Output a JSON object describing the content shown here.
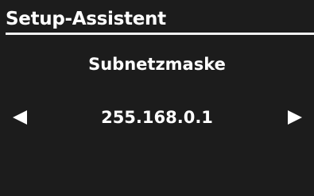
{
  "header": {
    "title": "Setup-Assistent"
  },
  "field": {
    "label": "Subnetzmaske",
    "value": "255.168.0.1"
  },
  "navigation": {
    "previous_icon": "arrow-left-icon",
    "next_icon": "arrow-right-icon"
  },
  "colors": {
    "background": "#1c1c1c",
    "text": "#ffffff",
    "rule": "#f2f2f2"
  }
}
